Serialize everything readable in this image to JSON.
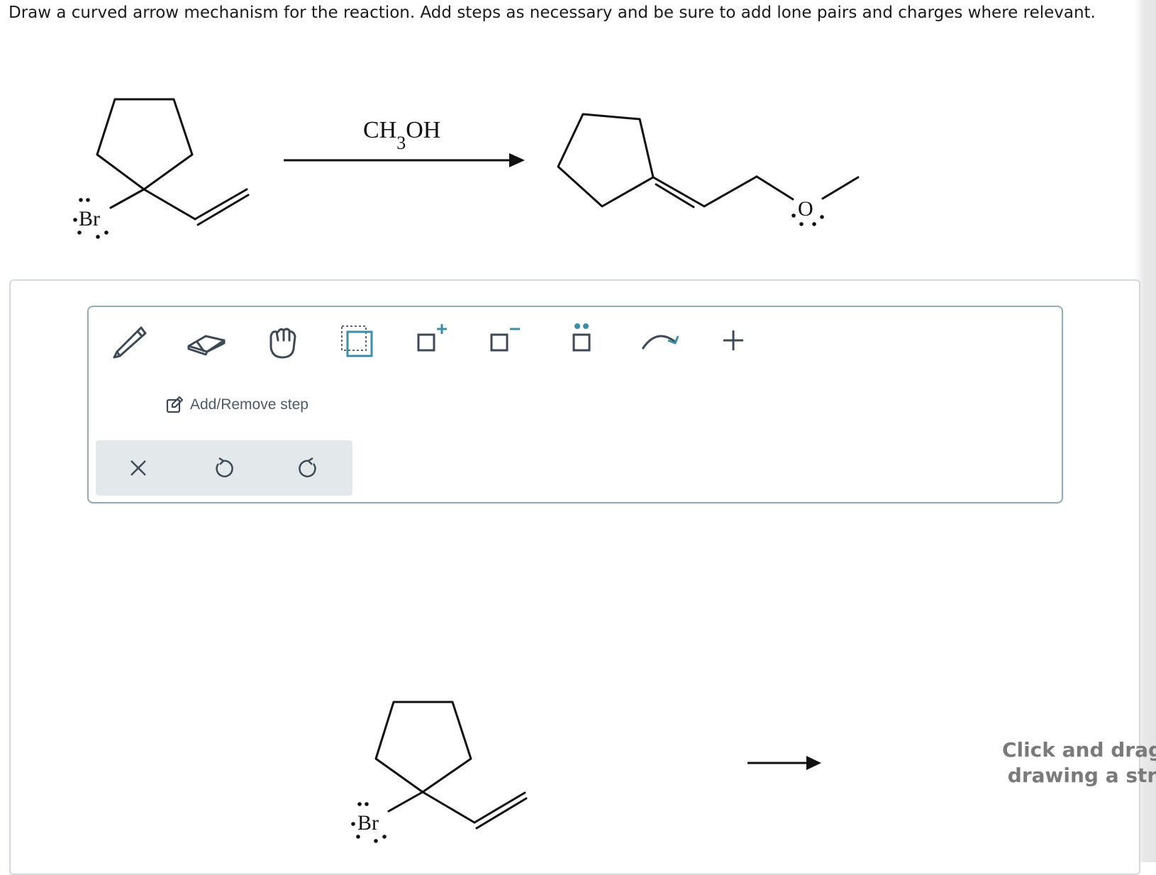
{
  "question": {
    "text": "Draw a curved arrow mechanism for the reaction. Add steps as necessary and be sure to add lone pairs and charges where relevant."
  },
  "reaction": {
    "reagent_main": "CH",
    "reagent_subscript": "3",
    "reagent_tail": "OH",
    "reactant_atom": "Br",
    "product_atom": "O"
  },
  "toolbar": {
    "tools": [
      "pencil-tool",
      "eraser-tool",
      "hand-tool",
      "select-box-tool",
      "positive-charge-tool",
      "negative-charge-tool",
      "lone-pair-tool",
      "curved-arrow-tool",
      "add-tool"
    ],
    "add_remove_label": "Add/Remove step"
  },
  "canvas": {
    "atom_label": "Br",
    "drag_hint_line1": "Click and drag",
    "drag_hint_line2": "drawing a str"
  },
  "colors": {
    "accent": "#3a8ea8",
    "toolbar_border": "#93a9b8",
    "action_bar": "#e3e8eb"
  }
}
